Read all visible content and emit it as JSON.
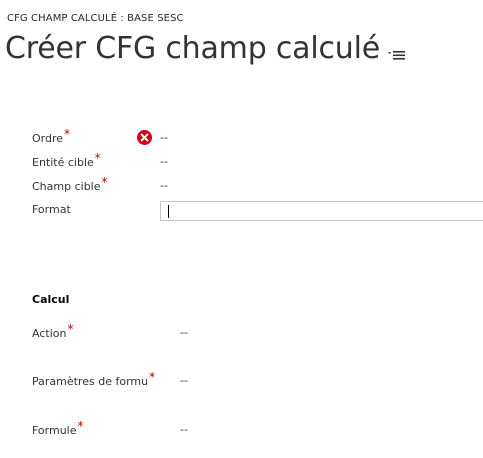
{
  "breadcrumb": "CFG CHAMP CALCULÉ : BASE SESC",
  "page_title": "Créer CFG champ calculé",
  "icons": {
    "title_menu": "menu-lines-icon",
    "error": "error-x-icon",
    "required": "required-asterisk"
  },
  "colors": {
    "required": "#c00000",
    "error": "#d0021b"
  },
  "general_fields": [
    {
      "label": "Ordre",
      "required": true,
      "value": "--",
      "error": true
    },
    {
      "label": "Entité cible",
      "required": true,
      "value": "--"
    },
    {
      "label": "Champ cible",
      "required": true,
      "value": "--"
    },
    {
      "label": "Format",
      "required": false,
      "value": ""
    }
  ],
  "calcul_section": {
    "title": "Calcul",
    "fields": [
      {
        "label": "Action",
        "required": true,
        "value": "--"
      },
      {
        "label": "Paramètres de formu",
        "required": true,
        "value": "--"
      },
      {
        "label": "Formule",
        "required": true,
        "value": "--"
      }
    ]
  },
  "required_marker": "*"
}
